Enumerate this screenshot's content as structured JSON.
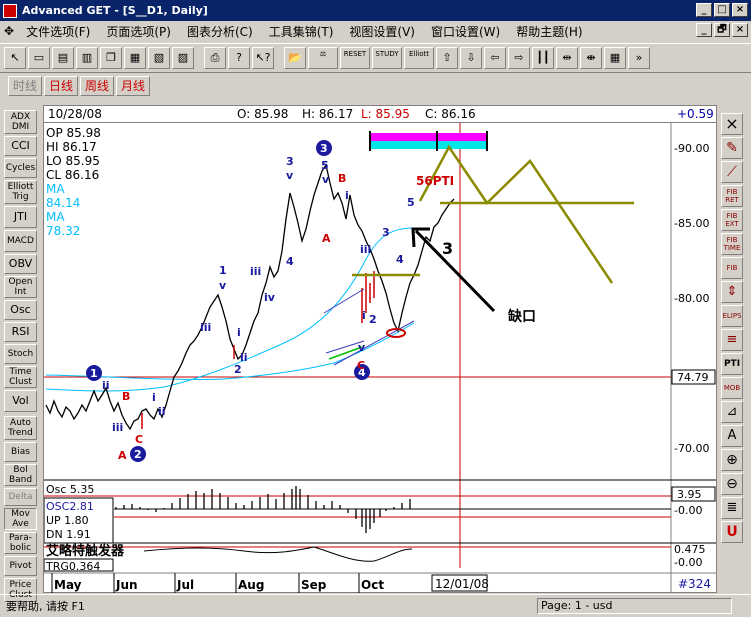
{
  "window": {
    "title": "Advanced GET - [S__D1, Daily]",
    "controls": [
      "_",
      "□",
      "×"
    ],
    "mdi_controls": [
      "_",
      "🗗",
      "×"
    ]
  },
  "menu": [
    "文件选项(F)",
    "页面选项(P)",
    "图表分析(C)",
    "工具集锦(T)",
    "视图设置(V)",
    "窗口设置(W)",
    "帮助主题(H)"
  ],
  "toolbar": {
    "reset_label": "RESET",
    "study_label": "STUDY",
    "elliott_label": "Elliott"
  },
  "periods": [
    {
      "label": "时线",
      "enabled": false
    },
    {
      "label": "日线",
      "enabled": true,
      "active": true
    },
    {
      "label": "周线",
      "enabled": true
    },
    {
      "label": "月线",
      "enabled": true
    }
  ],
  "left_tools": [
    "ADX DMI",
    "CCI",
    "Cycles",
    "Elliott Trig",
    "JTI",
    "MACD",
    "OBV",
    "Open Int",
    "Osc",
    "RSI",
    "Stoch",
    "Time Clust",
    "Vol",
    "Auto Trend",
    "Bias",
    "Bol Band",
    "Delta",
    "Mov Ave",
    "Para-bolic",
    "Pivot",
    "Price Clust"
  ],
  "right_tools": [
    "×",
    "✎",
    "⟋",
    "FIB RET",
    "FIB EXT",
    "FIB TIME",
    "FIB",
    "⇕",
    "ELIPS",
    "≡",
    "PTI",
    "MOB",
    "⊿",
    "A",
    "⊕",
    "⊖",
    "≣",
    "U"
  ],
  "header": {
    "date": "10/28/08",
    "open": "O: 85.98",
    "high": "H: 86.17",
    "low": "L: 85.95",
    "close": "C: 86.16",
    "change": "+0.59"
  },
  "info_box": {
    "op": "OP 85.98",
    "hi": "HI  86.17",
    "lo": "LO  85.95",
    "cl": "CL  86.16",
    "ma1": "MA 84.14",
    "ma2": "MA 78.32"
  },
  "price_axis": {
    "labels": [
      "-90.00",
      "-85.00",
      "-80.00",
      "74.79",
      "-70.00"
    ]
  },
  "osc_panel": {
    "title": "Osc 5.35",
    "osc": "OSC2.81",
    "up": "UP   1.80",
    "dn": "DN   1.91",
    "value": "3.95",
    "zero": "-0.00"
  },
  "trigger_panel": {
    "title": "艾略特触发器",
    "trg": "TRG0.364",
    "value": "0.475",
    "zero": "-0.00"
  },
  "date_axis": {
    "months": [
      "May",
      "Jun",
      "Jul",
      "Aug",
      "Sep",
      "Oct"
    ],
    "cursor_date": "12/01/08",
    "count": "#324"
  },
  "annotations": {
    "gap_label": "缺口",
    "wave_three": "3",
    "pti": "56PTI"
  },
  "wave_labels": {
    "one": "1",
    "two": "2",
    "three": "3",
    "four": "4",
    "five": "5",
    "roman_ii": "ii",
    "roman_iii": "iii",
    "roman_iv": "iv",
    "roman_v": "v",
    "roman_i": "i",
    "letter_a": "A",
    "letter_b": "B",
    "letter_c": "C"
  },
  "status": {
    "help": "要帮助, 请按 F1",
    "page": "Page: 1 - usd"
  },
  "colors": {
    "title_bg": "#0a246a",
    "candle": "#000000",
    "ma": "#00bfff",
    "wave_blue": "#1a1a9e",
    "wave_red": "#cc0000",
    "projection": "#8b8b00",
    "magenta": "#ff00ff",
    "cyan": "#00e5e5"
  }
}
